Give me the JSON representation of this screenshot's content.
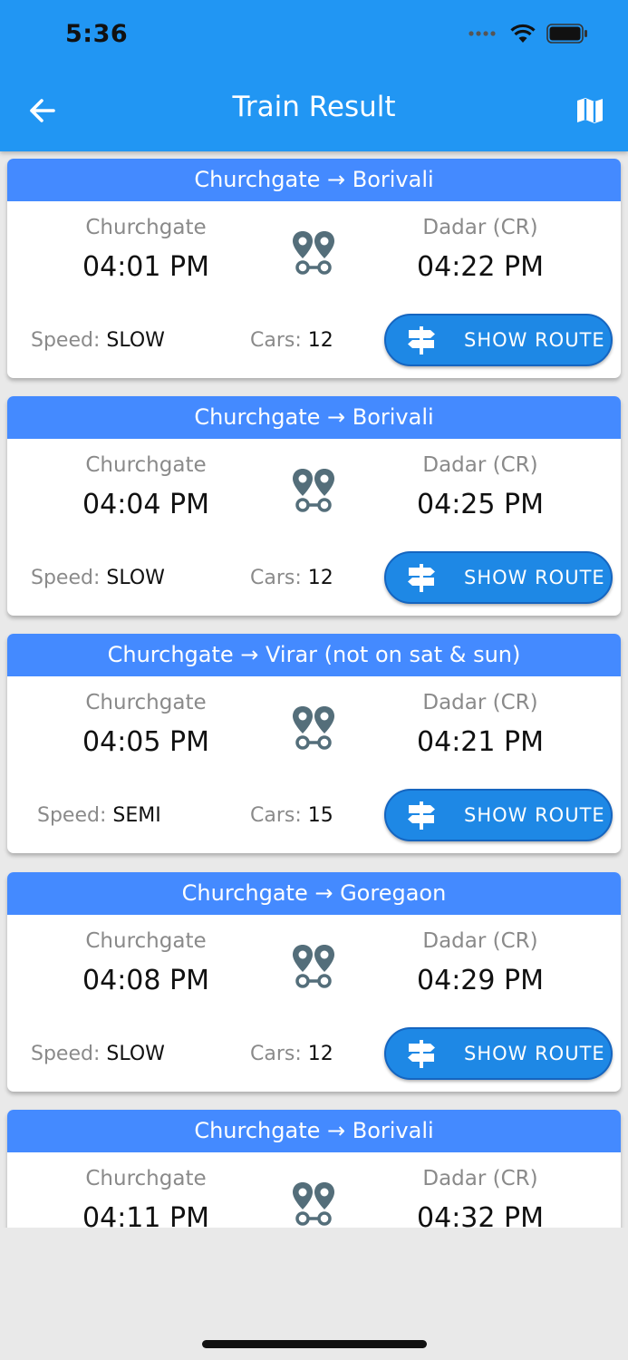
{
  "status_bar": {
    "time": "5:36"
  },
  "appbar": {
    "title": "Train Result"
  },
  "labels": {
    "speed": "Speed:",
    "cars": "Cars:",
    "show_route": "SHOW ROUTE"
  },
  "trains": [
    {
      "route": "Churchgate → Borivali",
      "from": "Churchgate",
      "from_time": "04:01 PM",
      "to": "Dadar (CR)",
      "to_time": "04:22 PM",
      "speed": "SLOW",
      "cars": "12"
    },
    {
      "route": "Churchgate → Borivali",
      "from": "Churchgate",
      "from_time": "04:04 PM",
      "to": "Dadar (CR)",
      "to_time": "04:25 PM",
      "speed": "SLOW",
      "cars": "12"
    },
    {
      "route": "Churchgate → Virar (not on sat & sun)",
      "from": "Churchgate",
      "from_time": "04:05 PM",
      "to": "Dadar (CR)",
      "to_time": "04:21 PM",
      "speed": "SEMI",
      "cars": "15"
    },
    {
      "route": "Churchgate → Goregaon",
      "from": "Churchgate",
      "from_time": "04:08 PM",
      "to": "Dadar (CR)",
      "to_time": "04:29 PM",
      "speed": "SLOW",
      "cars": "12"
    },
    {
      "route": "Churchgate → Borivali",
      "from": "Churchgate",
      "from_time": "04:11 PM",
      "to": "Dadar (CR)",
      "to_time": "04:32 PM"
    }
  ],
  "colors": {
    "appbar": "#2196f3",
    "card_header": "#448aff",
    "button": "#1e88e5",
    "icon": "#546e7a"
  }
}
